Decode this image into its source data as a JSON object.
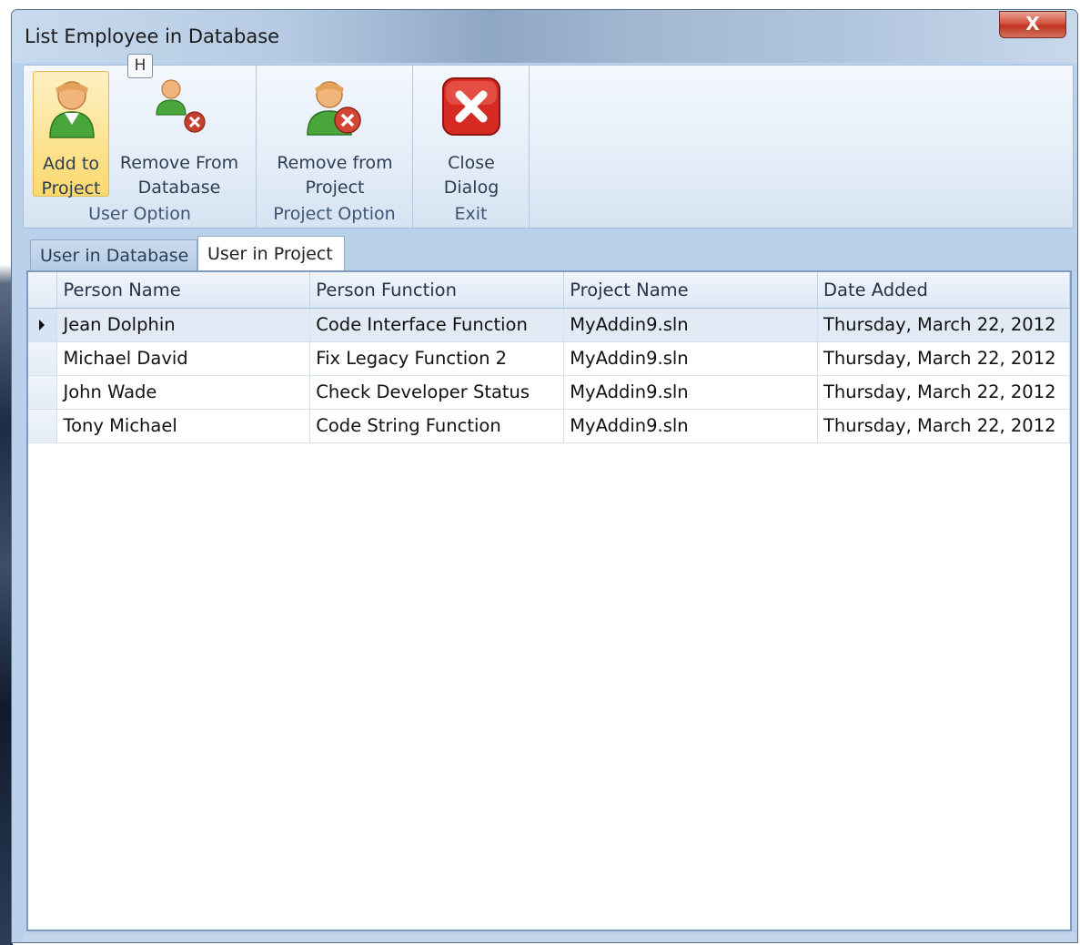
{
  "window": {
    "title": "List Employee in Database",
    "close_glyph": "X",
    "keytip": "H"
  },
  "ribbon": {
    "groups": [
      {
        "label": "User Option",
        "buttons": [
          {
            "line1": "Add to",
            "line2": "Project",
            "icon": "user-add-icon"
          },
          {
            "line1": "Remove From",
            "line2": "Database",
            "icon": "user-remove-icon"
          }
        ]
      },
      {
        "label": "Project Option",
        "buttons": [
          {
            "line1": "Remove from",
            "line2": "Project",
            "icon": "user-remove-large-icon"
          }
        ]
      },
      {
        "label": "Exit",
        "buttons": [
          {
            "line1": "Close",
            "line2": "Dialog",
            "icon": "close-red-icon"
          }
        ]
      }
    ]
  },
  "tabs": [
    {
      "label": "User in Database",
      "active": false
    },
    {
      "label": "User in Project",
      "active": true
    }
  ],
  "grid": {
    "columns": [
      "Person Name",
      "Person Function",
      "Project Name",
      "Date Added"
    ],
    "rows": [
      [
        "Jean Dolphin",
        "Code Interface Function",
        "MyAddin9.sln",
        "Thursday, March 22, 2012"
      ],
      [
        "Michael David",
        "Fix Legacy Function 2",
        "MyAddin9.sln",
        "Thursday, March 22, 2012"
      ],
      [
        "John Wade",
        "Check Developer Status",
        "MyAddin9.sln",
        "Thursday, March 22, 2012"
      ],
      [
        "Tony Michael",
        "Code String Function",
        "MyAddin9.sln",
        "Thursday, March 22, 2012"
      ]
    ],
    "selected_row": 0
  },
  "colors": {
    "accent_active": "#fde59a",
    "close_red": "#d3543f",
    "grid_border": "#7f9bc2"
  }
}
